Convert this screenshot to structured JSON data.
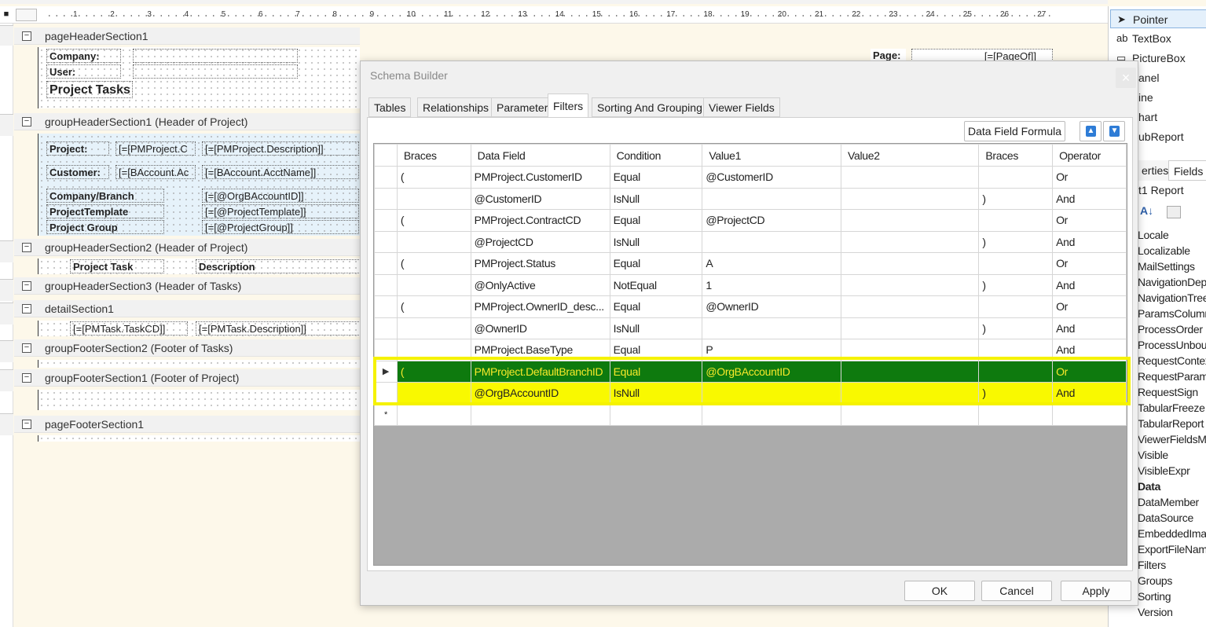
{
  "ruler": {
    "selector": "■",
    "ticks": [
      "1",
      "2",
      "3",
      "4",
      "5",
      "6",
      "7",
      "8",
      "9",
      "10",
      "11",
      "12",
      "13",
      "14",
      "15",
      "16",
      "17",
      "18",
      "19",
      "20",
      "21",
      "22",
      "23",
      "24",
      "25",
      "26",
      "27"
    ]
  },
  "designer": {
    "page_header": {
      "label": "pageHeaderSection1",
      "company_label": "Company:",
      "user_label": "User:",
      "title": "Project Tasks",
      "page_label": "Page:",
      "page_value": "[=[PageOf]]"
    },
    "group_header_1": {
      "label": "groupHeaderSection1 (Header of Project)",
      "project_label": "Project:",
      "project_cd": "[=[PMProject.C",
      "project_desc": "[=[PMProject.Description]]",
      "customer_label": "Customer:",
      "customer_cd": "[=[BAccount.Ac",
      "customer_name": "[=[BAccount.AcctName]]",
      "branch_label": "Company/Branch",
      "branch_value": "[=[@OrgBAccountID]]",
      "template_label": "ProjectTemplate",
      "template_value": "[=[@ProjectTemplate]]",
      "group_label": "Project Group",
      "group_value": "[=[@ProjectGroup]]"
    },
    "group_header_2": {
      "label": "groupHeaderSection2 (Header of Project)",
      "task_label": "Project Task",
      "desc_label": "Description"
    },
    "group_header_3": {
      "label": "groupHeaderSection3 (Header of Tasks)"
    },
    "detail": {
      "label": "detailSection1",
      "task_cd": "[=[PMTask.TaskCD]]",
      "task_desc": "[=[PMTask.Description]]"
    },
    "group_footer_2": {
      "label": "groupFooterSection2 (Footer of Tasks)"
    },
    "group_footer_1": {
      "label": "groupFooterSection1 (Footer of Project)"
    },
    "page_footer": {
      "label": "pageFooterSection1"
    }
  },
  "toolbox": {
    "items": [
      {
        "icon": "➤",
        "label": "Pointer"
      },
      {
        "icon": "ab",
        "label": "TextBox"
      },
      {
        "icon": "▭",
        "label": "PictureBox"
      },
      {
        "icon": "",
        "label": "anel"
      },
      {
        "icon": "",
        "label": "ine"
      },
      {
        "icon": "",
        "label": "hart"
      },
      {
        "icon": "",
        "label": "ubReport"
      }
    ]
  },
  "properties": {
    "tab_properties": "erties",
    "tab_fields": "Fields",
    "object": "t1 Report",
    "items": [
      "Locale",
      "Localizable",
      "MailSettings",
      "NavigationDep",
      "NavigationTree",
      "ParamsColumn",
      "ProcessOrder",
      "ProcessUnbou",
      "RequestContex",
      "RequestParam",
      "RequestSign",
      "TabularFreeze",
      "TabularReport",
      "ViewerFieldsMo",
      "Visible",
      "VisibleExpr",
      "Data",
      "DataMember",
      "DataSource",
      "EmbeddedImag",
      "ExportFileName",
      "Filters",
      "Groups",
      "Sorting",
      "Version"
    ]
  },
  "dialog": {
    "title": "Schema Builder",
    "close": "×",
    "tabs": [
      "Tables",
      "Relationships",
      "Parameters",
      "Filters",
      "Sorting And Grouping",
      "Viewer Fields"
    ],
    "active_tab": "Filters",
    "formula_button": "Data Field Formula",
    "columns": [
      "Braces",
      "Data Field",
      "Condition",
      "Value1",
      "Value2",
      "Braces",
      "Operator"
    ],
    "rows": [
      {
        "open": "(",
        "field": "PMProject.CustomerID",
        "condition": "Equal",
        "value1": "@CustomerID",
        "value2": "",
        "close": "",
        "operator": "Or"
      },
      {
        "open": "",
        "field": "@CustomerID",
        "condition": "IsNull",
        "value1": "",
        "value2": "",
        "close": ")",
        "operator": "And"
      },
      {
        "open": "(",
        "field": "PMProject.ContractCD",
        "condition": "Equal",
        "value1": "@ProjectCD",
        "value2": "",
        "close": "",
        "operator": "Or"
      },
      {
        "open": "",
        "field": "@ProjectCD",
        "condition": "IsNull",
        "value1": "",
        "value2": "",
        "close": ")",
        "operator": "And"
      },
      {
        "open": "(",
        "field": "PMProject.Status",
        "condition": "Equal",
        "value1": "A",
        "value2": "",
        "close": "",
        "operator": "Or"
      },
      {
        "open": "",
        "field": "@OnlyActive",
        "condition": "NotEqual",
        "value1": "1",
        "value2": "",
        "close": ")",
        "operator": "And"
      },
      {
        "open": "(",
        "field": "PMProject.OwnerID_desc...",
        "condition": "Equal",
        "value1": "@OwnerID",
        "value2": "",
        "close": "",
        "operator": "Or"
      },
      {
        "open": "",
        "field": "@OwnerID",
        "condition": "IsNull",
        "value1": "",
        "value2": "",
        "close": ")",
        "operator": "And"
      },
      {
        "open": "",
        "field": "PMProject.BaseType",
        "condition": "Equal",
        "value1": "P",
        "value2": "",
        "close": "",
        "operator": "And"
      },
      {
        "open": "(",
        "field": "PMProject.DefaultBranchID",
        "condition": "Equal",
        "value1": "@OrgBAccountID",
        "value2": "",
        "close": "",
        "operator": "Or"
      },
      {
        "open": "",
        "field": "@OrgBAccountID",
        "condition": "IsNull",
        "value1": "",
        "value2": "",
        "close": ")",
        "operator": "And"
      }
    ],
    "current_row_marker": "▶",
    "new_row_marker": "*",
    "ok_button": "OK",
    "cancel_button": "Cancel",
    "apply_button": "Apply"
  },
  "colors": {
    "selected_row": "#0e7a0e",
    "selected_text": "#f7e92a",
    "highlight": "#f9f900",
    "arrow_button": "#2e7cd6"
  }
}
